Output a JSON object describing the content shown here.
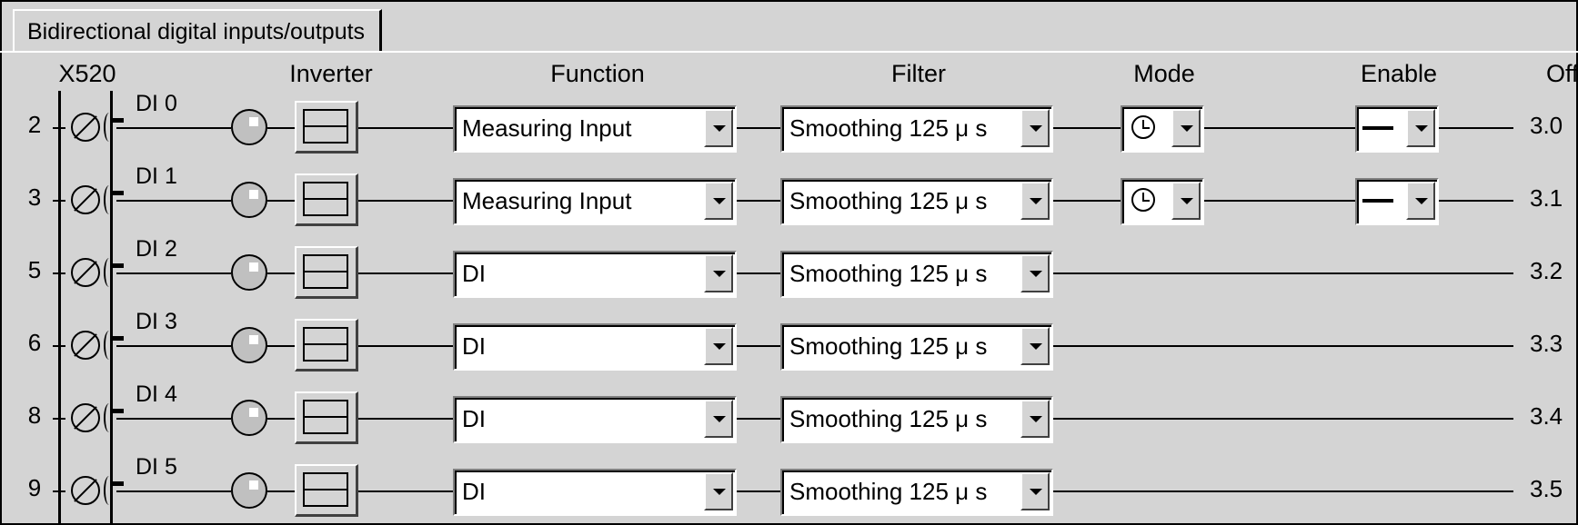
{
  "tab": {
    "label": "Bidirectional digital inputs/outputs"
  },
  "headers": {
    "terminal": "X520",
    "inverter": "Inverter",
    "function": "Function",
    "filter": "Filter",
    "mode": "Mode",
    "enable": "Enable",
    "offset": "Offse"
  },
  "rows": [
    {
      "pin": "2",
      "name": "DI 0",
      "function": "Measuring Input",
      "filter": "Smoothing 125  μ s",
      "mode": "clock-icon",
      "enable": "line-icon",
      "offset": "3.0"
    },
    {
      "pin": "3",
      "name": "DI 1",
      "function": "Measuring Input",
      "filter": "Smoothing 125  μ s",
      "mode": "clock-icon",
      "enable": "line-icon",
      "offset": "3.1"
    },
    {
      "pin": "5",
      "name": "DI 2",
      "function": "DI",
      "filter": "Smoothing 125  μ s",
      "offset": "3.2"
    },
    {
      "pin": "6",
      "name": "DI 3",
      "function": "DI",
      "filter": "Smoothing 125  μ s",
      "offset": "3.3"
    },
    {
      "pin": "8",
      "name": "DI 4",
      "function": "DI",
      "filter": "Smoothing 125  μ s",
      "offset": "3.4"
    },
    {
      "pin": "9",
      "name": "DI 5",
      "function": "DI",
      "filter": "Smoothing 125  μ s",
      "offset": "3.5"
    }
  ]
}
